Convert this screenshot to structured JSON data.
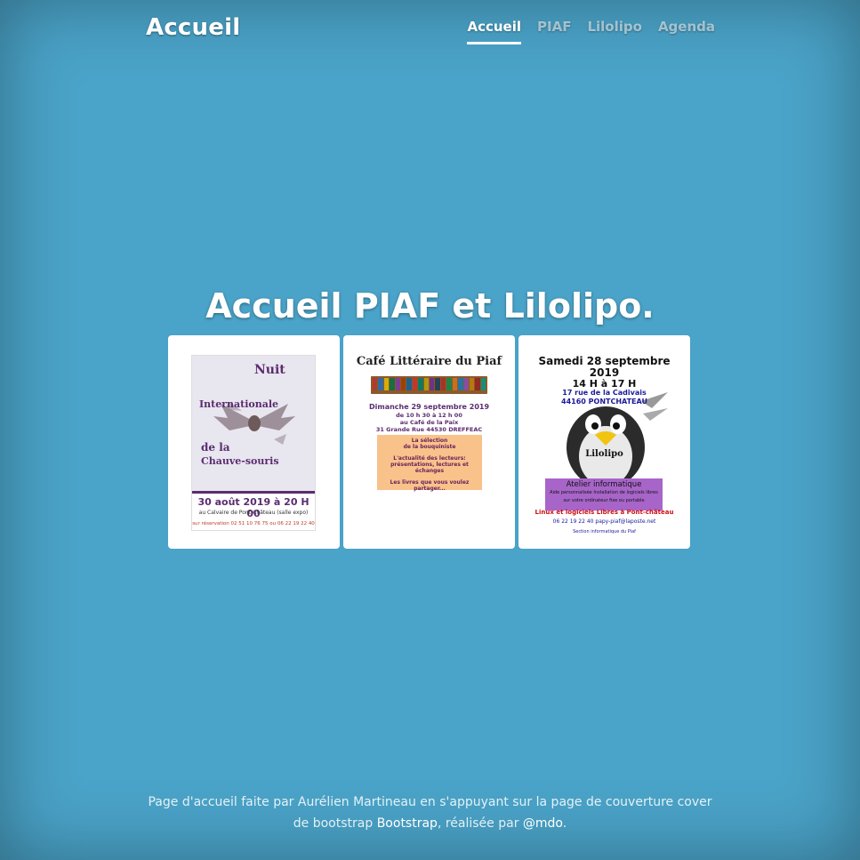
{
  "header": {
    "brand": "Accueil",
    "nav": [
      {
        "label": "Accueil",
        "active": true
      },
      {
        "label": "PIAF",
        "active": false
      },
      {
        "label": "Lilolipo",
        "active": false
      },
      {
        "label": "Agenda",
        "active": false
      }
    ]
  },
  "main": {
    "title": "Accueil PIAF et Lilolipo."
  },
  "cards": {
    "poster1": {
      "title_line1": "Nuit",
      "title_line2": "Internationale",
      "title_line3": "de la",
      "title_line4": "Chauve-souris",
      "date": "30 août 2019 à 20 H 00",
      "location": "au Calvaire de Pont-Château (salle expo)",
      "reservation": "sur réservation 02 51 10 76 75 ou 06 22 19 22 40"
    },
    "poster2": {
      "title": "Café Littéraire du Piaf",
      "date": "Dimanche 29 septembre 2019",
      "time": "de 10 h 30 à 12 h 00",
      "place": "au Café de la Paix",
      "address": "31 Grande Rue 44530 DREFFEAC",
      "box_line1": "La sélection",
      "box_line2": "de la bouquiniste",
      "box_line3": "L'actualité des lecteurs:",
      "box_line4": "présentations, lectures et échanges",
      "box_line5": "Les livres que vous voulez partager..."
    },
    "poster3": {
      "date_line1": "Samedi 28 septembre",
      "date_line2": "2019",
      "time": "14 H à 17 H",
      "address1": "17 rue de la Cadivais",
      "address2": "44160 PONTCHATEAU",
      "tux_label": "Lilolipo",
      "atelier": "Atelier informatique",
      "atelier_sub": "Aide personnalisée   Installation de logiciels libres",
      "atelier_sub2": "sur votre ordinateur fixe ou portable",
      "slogan": "Linux et logiciels Libres à Pont-château",
      "contact": "06 22 19 22 40  papy-piaf@laposte.net",
      "section": "Section informatique du Piaf"
    }
  },
  "footer": {
    "text1": "Page d'accueil faite par Aurélien Martineau en s'appuyant sur la page de couverture cover",
    "text2a": "de bootstrap ",
    "link1": "Bootstrap",
    "text2b": ", réalisée par ",
    "link2": "@mdo",
    "text2c": "."
  },
  "colors": {
    "background": "#4aa3c8",
    "purple": "#5b2c6f",
    "accent_purple": "#a865c9",
    "orange_box": "#f9c28b"
  }
}
